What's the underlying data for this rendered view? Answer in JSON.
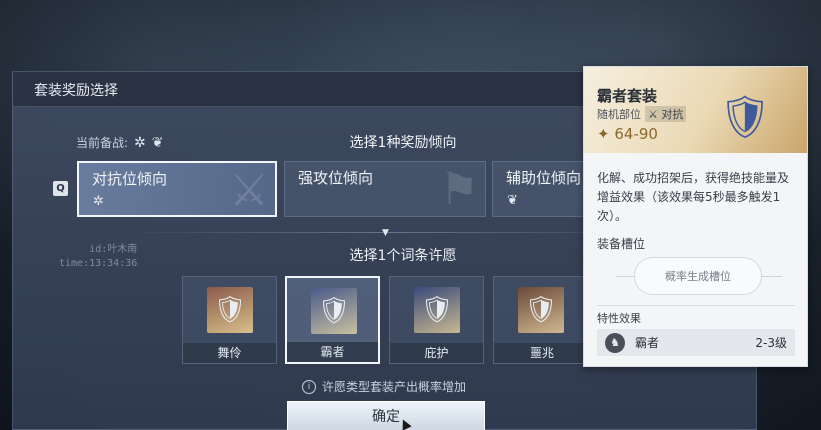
{
  "dialog": {
    "title": "套装奖励选择",
    "current_loadout_label": "当前备战:",
    "loadout_icons": [
      "star-emblem-icon",
      "lotus-emblem-icon"
    ]
  },
  "tendency": {
    "title": "选择1种奖励倾向",
    "hotkey": "Q",
    "options": [
      {
        "label": "对抗位倾向",
        "icon": "star-emblem-icon",
        "selected": true
      },
      {
        "label": "强攻位倾向",
        "icon": "",
        "selected": false
      },
      {
        "label": "辅助位倾向",
        "icon": "lotus-emblem-icon",
        "selected": false
      }
    ]
  },
  "meta": {
    "id_text": "id:叶木南",
    "time_text": "time:13:34:36"
  },
  "wish": {
    "title": "选择1个词条许愿",
    "options": [
      {
        "label": "舞伶",
        "selected": false
      },
      {
        "label": "霸者",
        "selected": true
      },
      {
        "label": "庇护",
        "selected": false
      },
      {
        "label": "噩兆",
        "selected": false
      }
    ],
    "hint": "许愿类型套装产出概率增加",
    "confirm_label": "确定"
  },
  "tooltip": {
    "name": "霸者套装",
    "slot_type": "随机部位",
    "role_tag": "对抗",
    "range": "64-90",
    "description": "化解、成功招架后，获得绝技能量及增益效果（该效果每5秒最多触发1次）。",
    "slot_title": "装备槽位",
    "slot_placeholder": "概率生成槽位",
    "trait_title": "特性效果",
    "trait_name": "霸者",
    "trait_level": "2-3级"
  },
  "colors": {
    "accent_gold": "#8a6a2a",
    "dialog_bg": "#3e4a60",
    "selected_border": "#f2f5f9"
  }
}
